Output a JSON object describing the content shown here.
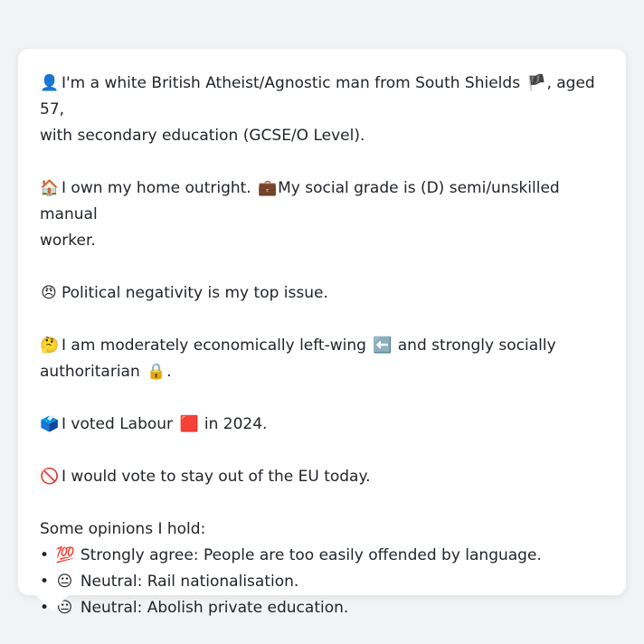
{
  "profile": {
    "identity": {
      "icon": "👤",
      "text1": "I'm a white British Atheist/Agnostic man from South Shields",
      "flag": "🏴",
      "text2": ", aged 57,",
      "text3": "with secondary education (GCSE/O Level)."
    },
    "home": {
      "icon": "🏠",
      "text1": "I own my home outright.",
      "icon2": "💼",
      "text2": "My social grade is (D) semi/unskilled manual",
      "text3": "worker."
    },
    "issue": {
      "icon": "😠",
      "text": "Political negativity is my top issue."
    },
    "ideology": {
      "icon": "🤔",
      "text1": "I am moderately economically left-wing",
      "icon2": "⬅️",
      "text2": "and strongly socially",
      "text3": "authoritarian",
      "icon3": "🔒",
      "text4": "."
    },
    "vote": {
      "icon": "🗳️",
      "text1": "I voted Labour",
      "icon2": "🟥",
      "text2": "in 2024."
    },
    "eu": {
      "icon": "🚫",
      "text": "I would vote to stay out of the EU today."
    },
    "opinions": {
      "heading": "Some opinions I hold:",
      "items": [
        {
          "bullet": "•",
          "icon": "💯",
          "text": "Strongly agree: People are too easily offended by language."
        },
        {
          "bullet": "•",
          "icon": "😐",
          "text": "Neutral: Rail nationalisation."
        },
        {
          "bullet": "•",
          "icon": "😐",
          "text": "Neutral: Abolish private education."
        }
      ]
    }
  }
}
